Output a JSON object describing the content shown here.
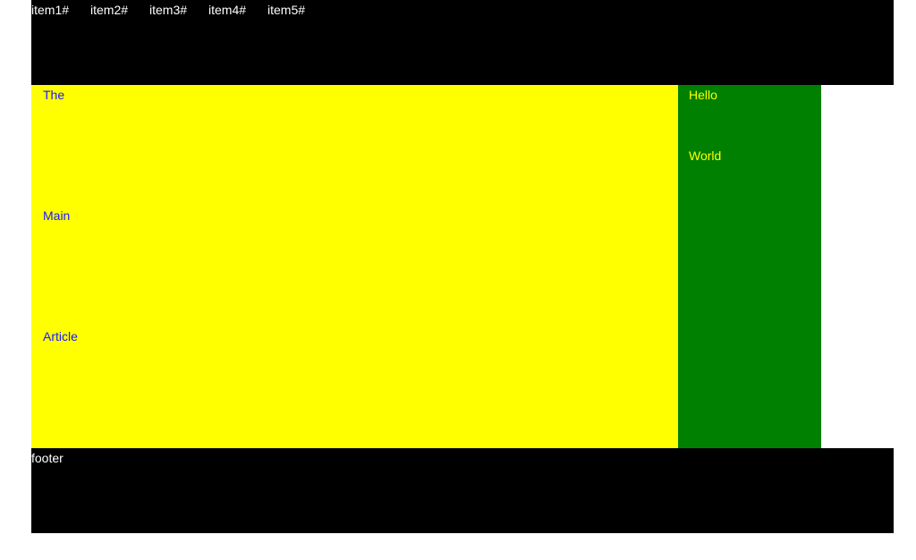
{
  "colors": {
    "header_bg": "#000000",
    "main_bg": "#ffff00",
    "aside_bg": "#008000",
    "footer_bg": "#000000",
    "nav_text": "#ffffff",
    "main_text": "#1a1aff",
    "aside_text": "#ffff00"
  },
  "header": {
    "nav_items": [
      "item1#",
      "item2#",
      "item3#",
      "item4#",
      "item5#"
    ]
  },
  "main": {
    "lines": [
      "The",
      "Main",
      "Article"
    ]
  },
  "aside": {
    "lines": [
      "Hello",
      "World"
    ]
  },
  "footer": {
    "text": "footer"
  }
}
